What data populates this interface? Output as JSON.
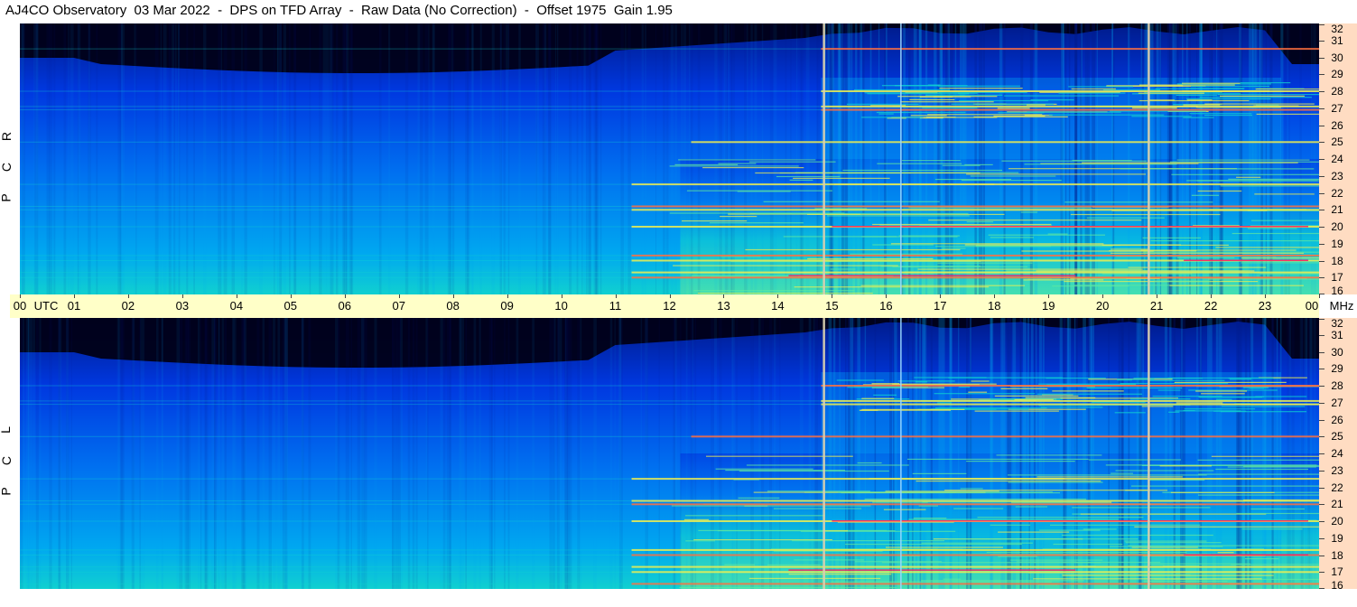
{
  "title": "AJ4CO Observatory  03 Mar 2022  -  DPS on TFD Array  -  Raw Data (No Correction)  -  Offset 1975  Gain 1.95",
  "chart_data": [
    {
      "type": "heatmap",
      "panel": "upper",
      "side_label": [
        "R",
        "C",
        "P"
      ],
      "freq_ticks": [
        "32",
        "31",
        "30",
        "29",
        "28",
        "27",
        "26",
        "25",
        "24",
        "23",
        "22",
        "21",
        "20",
        "19",
        "18",
        "17",
        "16"
      ],
      "freq_range_mhz": [
        16,
        32
      ],
      "time_range_utc": [
        0,
        24
      ],
      "vertical_markers_utc": [
        14.85,
        16.28,
        20.85
      ],
      "bright_lines_mhz": [
        17.0,
        17.3,
        18.0,
        18.3,
        20.0,
        21.0,
        21.2,
        22.5,
        25.0,
        26.9,
        27.1,
        28.0,
        30.5
      ],
      "colormap": [
        "#000016",
        "#001a8a",
        "#0038e0",
        "#0070f0",
        "#00a8f0",
        "#10d0d0",
        "#60e8a0",
        "#f0f050",
        "#ff7040",
        "#ff2060"
      ]
    },
    {
      "type": "heatmap",
      "panel": "lower",
      "side_label": [
        "L",
        "C",
        "P"
      ],
      "freq_ticks": [
        "32",
        "31",
        "30",
        "29",
        "28",
        "27",
        "26",
        "25",
        "24",
        "23",
        "22",
        "21",
        "20",
        "19",
        "18",
        "17",
        "16"
      ],
      "freq_range_mhz": [
        16,
        32
      ],
      "time_range_utc": [
        0,
        24
      ],
      "vertical_markers_utc": [
        14.85,
        16.28,
        20.85
      ],
      "bright_lines_mhz": [
        16.3,
        17.0,
        17.3,
        18.0,
        18.3,
        20.0,
        21.0,
        21.2,
        22.5,
        25.0,
        26.9,
        27.1,
        28.0
      ],
      "colormap": [
        "#000016",
        "#001a8a",
        "#0038e0",
        "#0070f0",
        "#00a8f0",
        "#10d0d0",
        "#60e8a0",
        "#f0f050",
        "#ff7040",
        "#ff2060"
      ]
    }
  ],
  "time_axis": {
    "ticks": [
      "00",
      "01",
      "02",
      "03",
      "04",
      "05",
      "06",
      "07",
      "08",
      "09",
      "10",
      "11",
      "12",
      "13",
      "14",
      "15",
      "16",
      "17",
      "18",
      "19",
      "20",
      "21",
      "22",
      "23",
      "00"
    ],
    "utc_label": "UTC",
    "unit_label": "MHz"
  }
}
